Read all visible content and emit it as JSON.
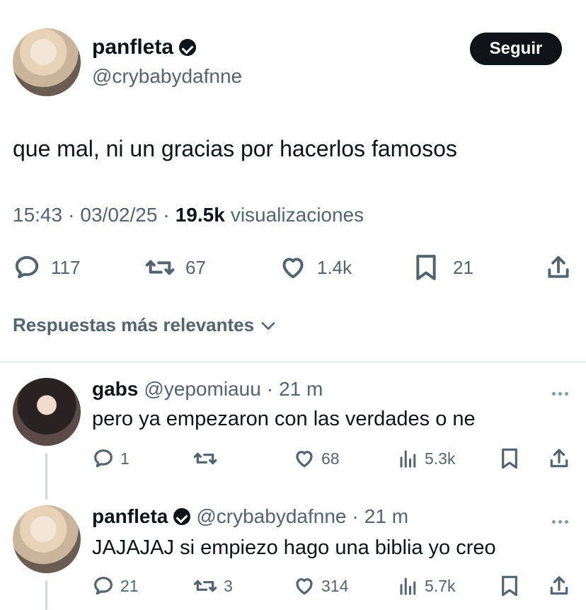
{
  "tweet": {
    "author_name": "panfleta",
    "author_handle": "@crybabydafnne",
    "follow_label": "Seguir",
    "text": "que mal, ni un gracias por hacerlos famosos",
    "time": "15:43",
    "date": "03/02/25",
    "views_count": "19.5k",
    "views_label": "visualizaciones",
    "replies": "117",
    "retweets": "67",
    "likes": "1.4k",
    "bookmarks": "21"
  },
  "replies_sort_label": "Respuestas más relevantes",
  "replies": [
    {
      "author_name": "gabs",
      "author_handle": "@yepomiauu",
      "time": "21 m",
      "text": "pero ya empezaron con las verdades o ne",
      "replies": "1",
      "retweets": "",
      "likes": "68",
      "views": "5.3k"
    },
    {
      "author_name": "panfleta",
      "author_handle": "@crybabydafnne",
      "time": "21 m",
      "text": "JAJAJAJ si empiezo hago una biblia yo creo",
      "replies": "21",
      "retweets": "3",
      "likes": "314",
      "views": "5.7k"
    }
  ],
  "separator_dot": "·",
  "icons": [
    "verified-icon",
    "reply-icon",
    "retweet-icon",
    "like-icon",
    "bookmark-icon",
    "share-icon",
    "chevron-down-icon",
    "views-icon",
    "more-icon"
  ]
}
